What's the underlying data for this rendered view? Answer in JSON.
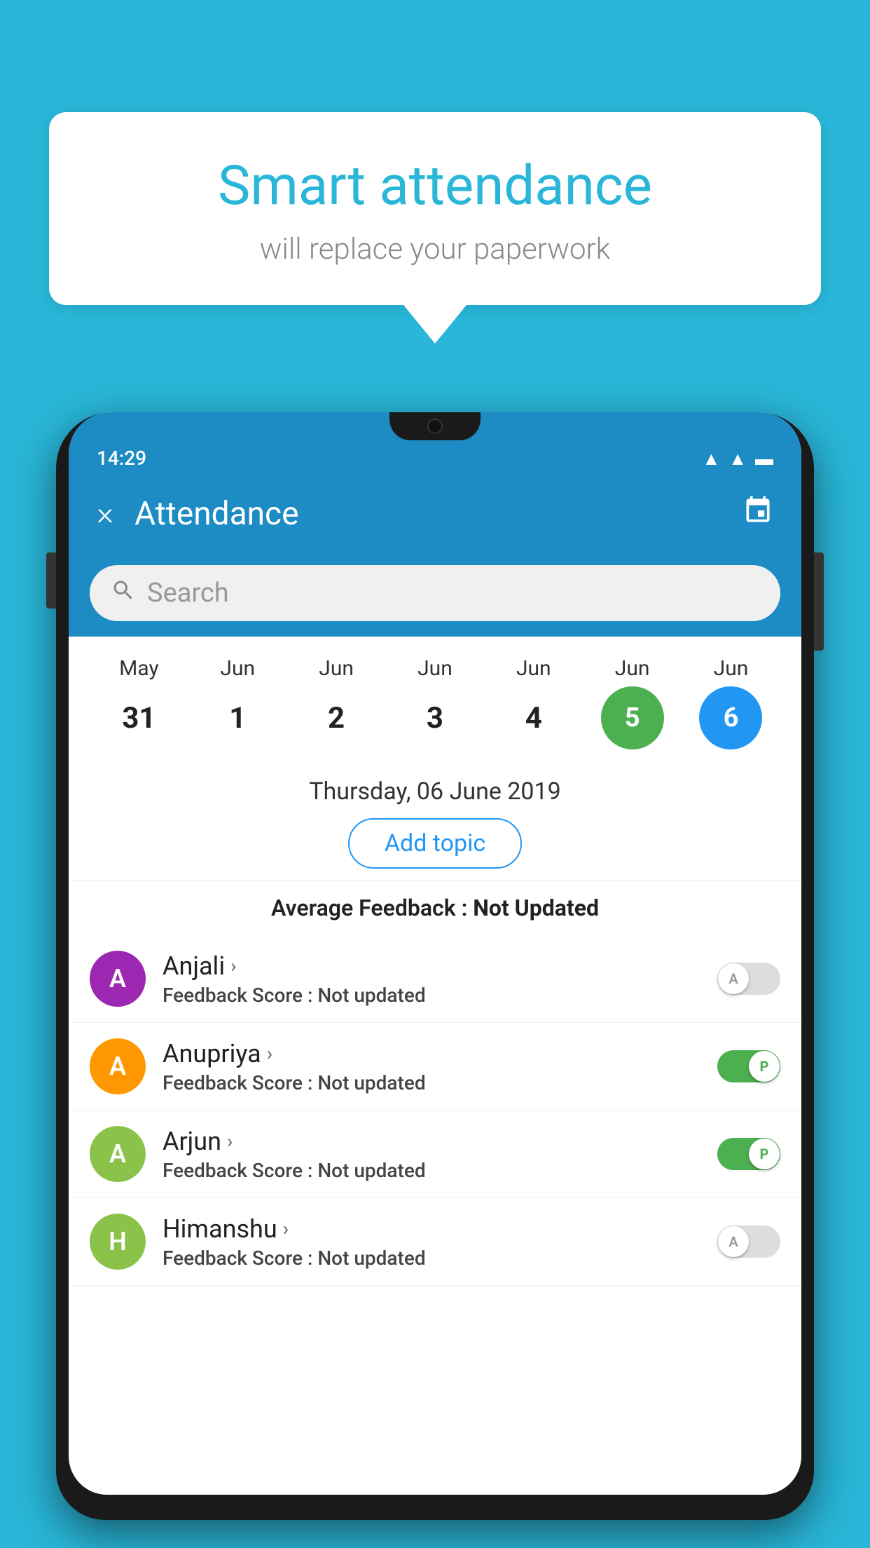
{
  "background_color": "#29b6d8",
  "speech_bubble": {
    "title": "Smart attendance",
    "subtitle": "will replace your paperwork"
  },
  "status_bar": {
    "time": "14:29"
  },
  "app_header": {
    "title": "Attendance",
    "close_label": "×",
    "calendar_icon": "📅"
  },
  "search": {
    "placeholder": "Search"
  },
  "calendar": {
    "months": [
      "May",
      "Jun",
      "Jun",
      "Jun",
      "Jun",
      "Jun",
      "Jun"
    ],
    "dates": [
      "31",
      "1",
      "2",
      "3",
      "4",
      "5",
      "6"
    ],
    "active_green_index": 5,
    "active_blue_index": 6
  },
  "selected_date": {
    "full": "Thursday, 06 June 2019",
    "add_topic_label": "Add topic",
    "feedback_label": "Average Feedback : ",
    "feedback_value": "Not Updated"
  },
  "students": [
    {
      "name": "Anjali",
      "feedback_label": "Feedback Score : ",
      "feedback_value": "Not updated",
      "avatar_letter": "A",
      "avatar_color": "#9c27b0",
      "toggle_state": "off",
      "toggle_letter": "A"
    },
    {
      "name": "Anupriya",
      "feedback_label": "Feedback Score : ",
      "feedback_value": "Not updated",
      "avatar_letter": "A",
      "avatar_color": "#ff9800",
      "toggle_state": "on",
      "toggle_letter": "P"
    },
    {
      "name": "Arjun",
      "feedback_label": "Feedback Score : ",
      "feedback_value": "Not updated",
      "avatar_letter": "A",
      "avatar_color": "#8bc34a",
      "toggle_state": "on",
      "toggle_letter": "P"
    },
    {
      "name": "Himanshu",
      "feedback_label": "Feedback Score : ",
      "feedback_value": "Not updated",
      "avatar_letter": "H",
      "avatar_color": "#8bc34a",
      "toggle_state": "off",
      "toggle_letter": "A"
    }
  ]
}
